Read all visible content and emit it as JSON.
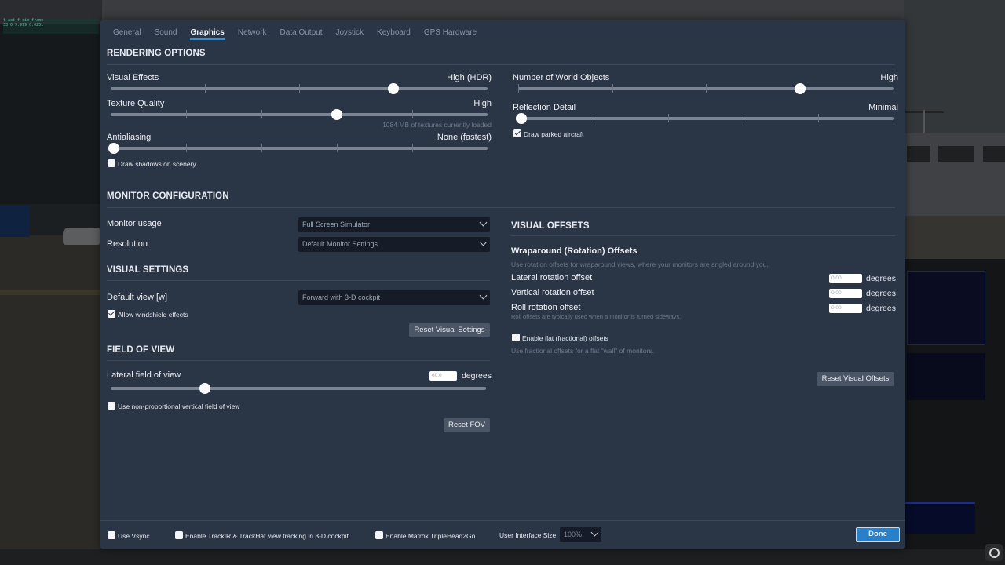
{
  "window": {
    "tabs": [
      {
        "label": "General",
        "active": false
      },
      {
        "label": "Sound",
        "active": false
      },
      {
        "label": "Graphics",
        "active": true
      },
      {
        "label": "Network",
        "active": false
      },
      {
        "label": "Data Output",
        "active": false
      },
      {
        "label": "Joystick",
        "active": false
      },
      {
        "label": "Keyboard",
        "active": false
      },
      {
        "label": "GPS Hardware",
        "active": false
      }
    ]
  },
  "rendering": {
    "title": "RENDERING OPTIONS",
    "visual_effects": {
      "label": "Visual Effects",
      "value": "High (HDR)",
      "position": 0.75,
      "steps": 4
    },
    "texture_quality": {
      "label": "Texture Quality",
      "value": "High",
      "position": 0.6,
      "steps": 5,
      "hint": "1084 MB of textures currently loaded"
    },
    "antialiasing": {
      "label": "Antialiasing",
      "value": "None (fastest)",
      "position": 0.0,
      "steps": 5
    },
    "draw_shadows": {
      "label": "Draw shadows on scenery",
      "checked": false
    },
    "world_objects": {
      "label": "Number of World Objects",
      "value": "High",
      "position": 0.75,
      "steps": 4
    },
    "reflection_detail": {
      "label": "Reflection Detail",
      "value": "Minimal",
      "position": 0.0,
      "steps": 5
    },
    "draw_parked_aircraft": {
      "label": "Draw parked aircraft",
      "checked": true
    }
  },
  "monitor": {
    "title": "MONITOR CONFIGURATION",
    "usage": {
      "label": "Monitor usage",
      "value": "Full Screen Simulator"
    },
    "resolution": {
      "label": "Resolution",
      "value": "Default Monitor Settings"
    }
  },
  "visual_settings": {
    "title": "VISUAL SETTINGS",
    "default_view": {
      "label": "Default view [w]",
      "value": "Forward with 3-D cockpit"
    },
    "windshield": {
      "label": "Allow windshield effects",
      "checked": true
    },
    "reset_label": "Reset Visual Settings"
  },
  "fov": {
    "title": "FIELD OF VIEW",
    "lateral": {
      "label": "Lateral field of view",
      "value": "60.0",
      "unit": "degrees",
      "position": 0.25
    },
    "non_proportional": {
      "label": "Use non-proportional vertical field of view",
      "checked": false
    },
    "reset_label": "Reset FOV"
  },
  "visual_offsets": {
    "title": "VISUAL OFFSETS",
    "wraparound_title": "Wraparound (Rotation) Offsets",
    "wraparound_hint": "Use rotation offsets for wraparound views, where your monitors are angled around you.",
    "lateral": {
      "label": "Lateral rotation offset",
      "value": "0.00",
      "unit": "degrees"
    },
    "vertical": {
      "label": "Vertical rotation offset",
      "value": "0.00",
      "unit": "degrees"
    },
    "roll": {
      "label": "Roll rotation offset",
      "value": "0.00",
      "unit": "degrees"
    },
    "roll_hint": "Roll offsets are typically used when a monitor is turned sideways.",
    "flat": {
      "label": "Enable flat (fractional) offsets",
      "checked": false
    },
    "flat_hint": "Use fractional offsets for a flat \"wall\" of monitors.",
    "reset_label": "Reset Visual Offsets"
  },
  "footer": {
    "vsync": {
      "label": "Use Vsync",
      "checked": false
    },
    "trackir": {
      "label": "Enable TrackIR & TrackHat view tracking in 3-D cockpit",
      "checked": false
    },
    "matrox": {
      "label": "Enable Matrox TripleHead2Go",
      "checked": false
    },
    "ui_size_label": "User Interface Size",
    "ui_size_value": "100%",
    "done_label": "Done"
  },
  "colors": {
    "dialog_bg": "#2a3546",
    "accent": "#2a80c8",
    "tab_underline": "#3a8fd0"
  }
}
